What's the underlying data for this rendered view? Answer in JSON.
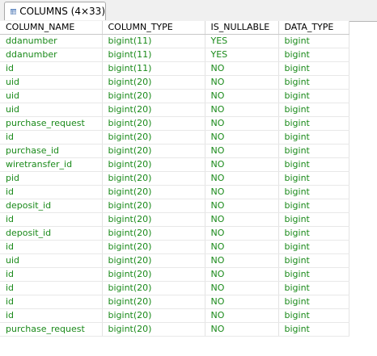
{
  "tab": {
    "icon": "table-grid-icon",
    "label": "COLUMNS (4×33)"
  },
  "colors": {
    "cell_text": "#1a8a1a",
    "header_text": "#000000"
  },
  "table": {
    "headers": [
      "COLUMN_NAME",
      "COLUMN_TYPE",
      "IS_NULLABLE",
      "DATA_TYPE"
    ],
    "rows": [
      [
        "ddanumber",
        "bigint(11)",
        "YES",
        "bigint"
      ],
      [
        "ddanumber",
        "bigint(11)",
        "YES",
        "bigint"
      ],
      [
        "id",
        "bigint(11)",
        "NO",
        "bigint"
      ],
      [
        "uid",
        "bigint(20)",
        "NO",
        "bigint"
      ],
      [
        "uid",
        "bigint(20)",
        "NO",
        "bigint"
      ],
      [
        "uid",
        "bigint(20)",
        "NO",
        "bigint"
      ],
      [
        "purchase_request",
        "bigint(20)",
        "NO",
        "bigint"
      ],
      [
        "id",
        "bigint(20)",
        "NO",
        "bigint"
      ],
      [
        "purchase_id",
        "bigint(20)",
        "NO",
        "bigint"
      ],
      [
        "wiretransfer_id",
        "bigint(20)",
        "NO",
        "bigint"
      ],
      [
        "pid",
        "bigint(20)",
        "NO",
        "bigint"
      ],
      [
        "id",
        "bigint(20)",
        "NO",
        "bigint"
      ],
      [
        "deposit_id",
        "bigint(20)",
        "NO",
        "bigint"
      ],
      [
        "id",
        "bigint(20)",
        "NO",
        "bigint"
      ],
      [
        "deposit_id",
        "bigint(20)",
        "NO",
        "bigint"
      ],
      [
        "id",
        "bigint(20)",
        "NO",
        "bigint"
      ],
      [
        "uid",
        "bigint(20)",
        "NO",
        "bigint"
      ],
      [
        "id",
        "bigint(20)",
        "NO",
        "bigint"
      ],
      [
        "id",
        "bigint(20)",
        "NO",
        "bigint"
      ],
      [
        "id",
        "bigint(20)",
        "NO",
        "bigint"
      ],
      [
        "id",
        "bigint(20)",
        "NO",
        "bigint"
      ],
      [
        "purchase_request",
        "bigint(20)",
        "NO",
        "bigint"
      ]
    ]
  }
}
